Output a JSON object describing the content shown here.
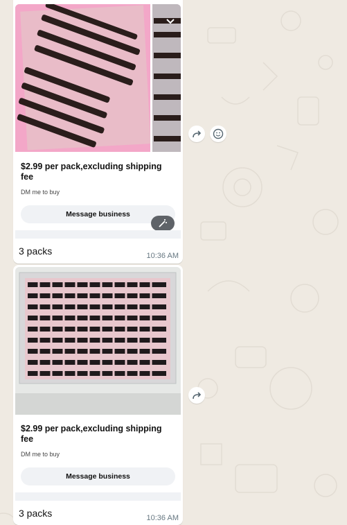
{
  "messages": [
    {
      "caption_title": "$2.99 per pack,excluding shipping fee",
      "caption_sub": "DM me to buy",
      "button_label": "Message business",
      "body": "3 packs",
      "time": "10:36 AM"
    },
    {
      "caption_title": "$2.99  per pack,excluding shipping fee",
      "caption_sub": "DM me to buy",
      "button_label": "Message business",
      "body": "3 packs",
      "time": "10:36 AM"
    }
  ],
  "icons": {
    "forward": "forward-icon",
    "emoji": "emoji-icon",
    "chevron": "chevron-down-icon",
    "magic": "magic-wand-icon"
  },
  "colors": {
    "chat_bg": "#efeae2",
    "bubble": "#ffffff",
    "timestamp": "#667781"
  }
}
